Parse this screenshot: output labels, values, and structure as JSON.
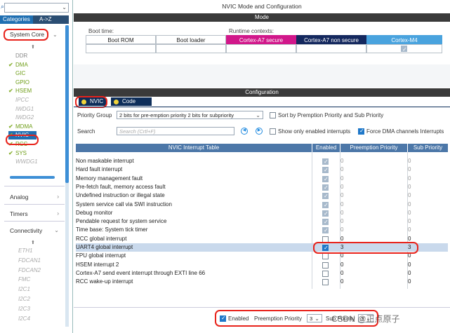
{
  "left": {
    "search_value": "",
    "tabs": [
      "Categories",
      "A->Z"
    ],
    "system_core": "System Core",
    "items": [
      {
        "label": "DDR",
        "state": "plain"
      },
      {
        "label": "DMA",
        "state": "check"
      },
      {
        "label": "GIC",
        "state": "green"
      },
      {
        "label": "GPIO",
        "state": "green"
      },
      {
        "label": "HSEM",
        "state": "check"
      },
      {
        "label": "IPCC",
        "state": "italic"
      },
      {
        "label": "IWDG1",
        "state": "italic"
      },
      {
        "label": "IWDG2",
        "state": "italic"
      },
      {
        "label": "MDMA",
        "state": "check"
      },
      {
        "label": "NVIC",
        "state": "check-selected"
      },
      {
        "label": "RCC",
        "state": "check"
      },
      {
        "label": "SYS",
        "state": "check"
      },
      {
        "label": "WWDG1",
        "state": "italic"
      }
    ],
    "categories": [
      "Analog",
      "Timers",
      "Connectivity"
    ],
    "connectivity_items": [
      "ETH1",
      "FDCAN1",
      "FDCAN2",
      "FMC",
      "I2C1",
      "I2C2",
      "I2C3",
      "I2C4"
    ]
  },
  "header": {
    "title": "NVIC Mode and Configuration",
    "mode_bar": "Mode",
    "config_bar": "Configuration"
  },
  "mode": {
    "boot_time": "Boot time:",
    "runtime_contexts": "Runtime contexts:",
    "cols": [
      "Boot ROM",
      "Boot loader",
      "Cortex-A7 secure",
      "Cortex-A7 non secure",
      "Cortex-M4"
    ],
    "colors": {
      "a7_secure": "#d1178a",
      "a7_non_secure": "#14285e",
      "m4": "#49a3de"
    }
  },
  "config": {
    "tabs": [
      "NVIC",
      "Code generation"
    ],
    "priority_group_label": "Priority Group",
    "priority_group_value": "2 bits for pre-emption priority 2 bits for subpriority",
    "sort_label": "Sort by Premption Priority and Sub Priority",
    "search_label": "Search",
    "search_placeholder": "Search (Crtl+F)",
    "show_enabled_label": "Show only enabled interrupts",
    "force_dma_label": "Force DMA channels Interrupts"
  },
  "table": {
    "headers": [
      "NVIC Interrupt Table",
      "Enabled",
      "Preemption Priority",
      "Sub Priority"
    ],
    "rows": [
      {
        "name": "Non maskable interrupt",
        "enabled": true,
        "locked": true,
        "pp": "0",
        "sp": "0"
      },
      {
        "name": "Hard fault interrupt",
        "enabled": true,
        "locked": true,
        "pp": "0",
        "sp": "0"
      },
      {
        "name": "Memory management fault",
        "enabled": true,
        "locked": true,
        "pp": "0",
        "sp": "0"
      },
      {
        "name": "Pre-fetch fault, memory access fault",
        "enabled": true,
        "locked": true,
        "pp": "0",
        "sp": "0"
      },
      {
        "name": "Undefined instruction or illegal state",
        "enabled": true,
        "locked": true,
        "pp": "0",
        "sp": "0"
      },
      {
        "name": "System service call via SWI instruction",
        "enabled": true,
        "locked": true,
        "pp": "0",
        "sp": "0"
      },
      {
        "name": "Debug monitor",
        "enabled": true,
        "locked": true,
        "pp": "0",
        "sp": "0"
      },
      {
        "name": "Pendable request for system service",
        "enabled": true,
        "locked": true,
        "pp": "0",
        "sp": "0"
      },
      {
        "name": "Time base: System tick timer",
        "enabled": true,
        "locked": true,
        "pp": "0",
        "sp": "0"
      },
      {
        "name": "RCC global interrupt",
        "enabled": false,
        "locked": false,
        "pp": "0",
        "sp": "0"
      },
      {
        "name": "UART4 global interrupt",
        "enabled": true,
        "locked": false,
        "pp": "3",
        "sp": "3",
        "selected": true
      },
      {
        "name": "FPU global interrupt",
        "enabled": false,
        "locked": false,
        "pp": "0",
        "sp": "0"
      },
      {
        "name": "HSEM interrupt 2",
        "enabled": false,
        "locked": false,
        "pp": "0",
        "sp": "0"
      },
      {
        "name": "Cortex-A7 send event interrupt through EXTI line 66",
        "enabled": false,
        "locked": false,
        "pp": "0",
        "sp": "0"
      },
      {
        "name": "RCC wake-up interrupt",
        "enabled": false,
        "locked": false,
        "pp": "0",
        "sp": "0"
      }
    ]
  },
  "bottom": {
    "enabled_label": "Enabled",
    "preemption_label": "Preemption Priority",
    "preemption_value": "3",
    "sub_label": "Sub Priority",
    "sub_value": "3"
  },
  "watermark": "CSDN @正点原子"
}
